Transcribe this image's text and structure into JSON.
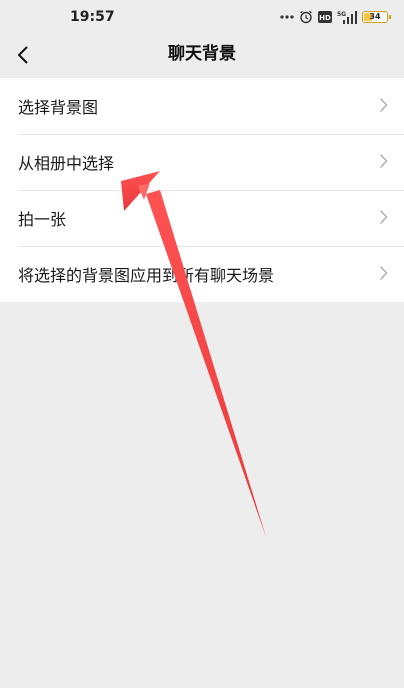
{
  "status_bar": {
    "time": "19:57",
    "network": "5G",
    "hd": "HD",
    "battery_level": "34",
    "icons": [
      "more-dots-icon",
      "alarm-icon",
      "hd-icon",
      "signal-5g-icon",
      "battery-icon"
    ]
  },
  "nav": {
    "title": "聊天背景",
    "back_icon": "chevron-left-icon"
  },
  "menu": {
    "items": [
      {
        "label": "选择背景图"
      },
      {
        "label": "从相册中选择"
      },
      {
        "label": "拍一张"
      },
      {
        "label": "将选择的背景图应用到所有聊天场景"
      }
    ],
    "chevron_icon": "chevron-right-icon"
  },
  "annotation": {
    "arrow_color": "#f24545",
    "target": "从相册中选择"
  }
}
